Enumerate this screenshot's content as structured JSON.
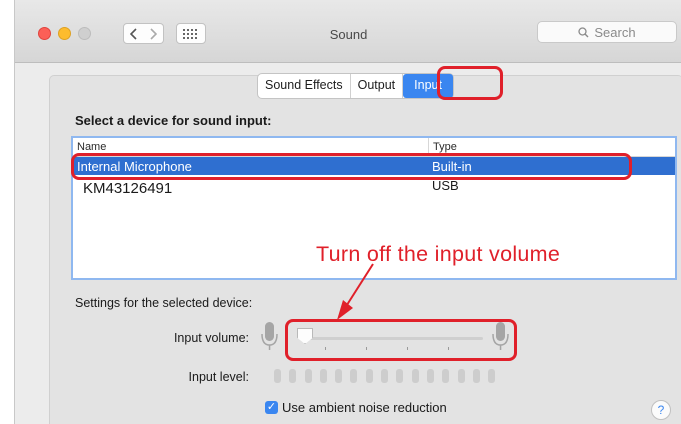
{
  "window": {
    "title": "Sound"
  },
  "search": {
    "placeholder": "Search"
  },
  "tabs": [
    {
      "label": "Sound Effects"
    },
    {
      "label": "Output"
    },
    {
      "label": "Input"
    }
  ],
  "device_section": {
    "heading": "Select a device for sound input:",
    "columns": {
      "name": "Name",
      "type": "Type"
    },
    "rows": [
      {
        "name": "Internal Microphone",
        "type": "Built-in",
        "selected": true
      },
      {
        "name": "KM43126491",
        "type": "USB",
        "selected": false
      }
    ]
  },
  "annotation": {
    "text": "Turn off the input volume",
    "color": "#e0202a"
  },
  "settings": {
    "heading": "Settings for the selected device:",
    "input_volume_label": "Input volume:",
    "input_volume_value": 0,
    "input_level_label": "Input level:",
    "input_level_value": 0,
    "noise_reduction_label": "Use ambient noise reduction",
    "noise_reduction_checked": true
  },
  "help": {
    "label": "?"
  },
  "colors": {
    "accent": "#3a86f0",
    "selection": "#2f6fd0",
    "highlight": "#e0202a"
  }
}
